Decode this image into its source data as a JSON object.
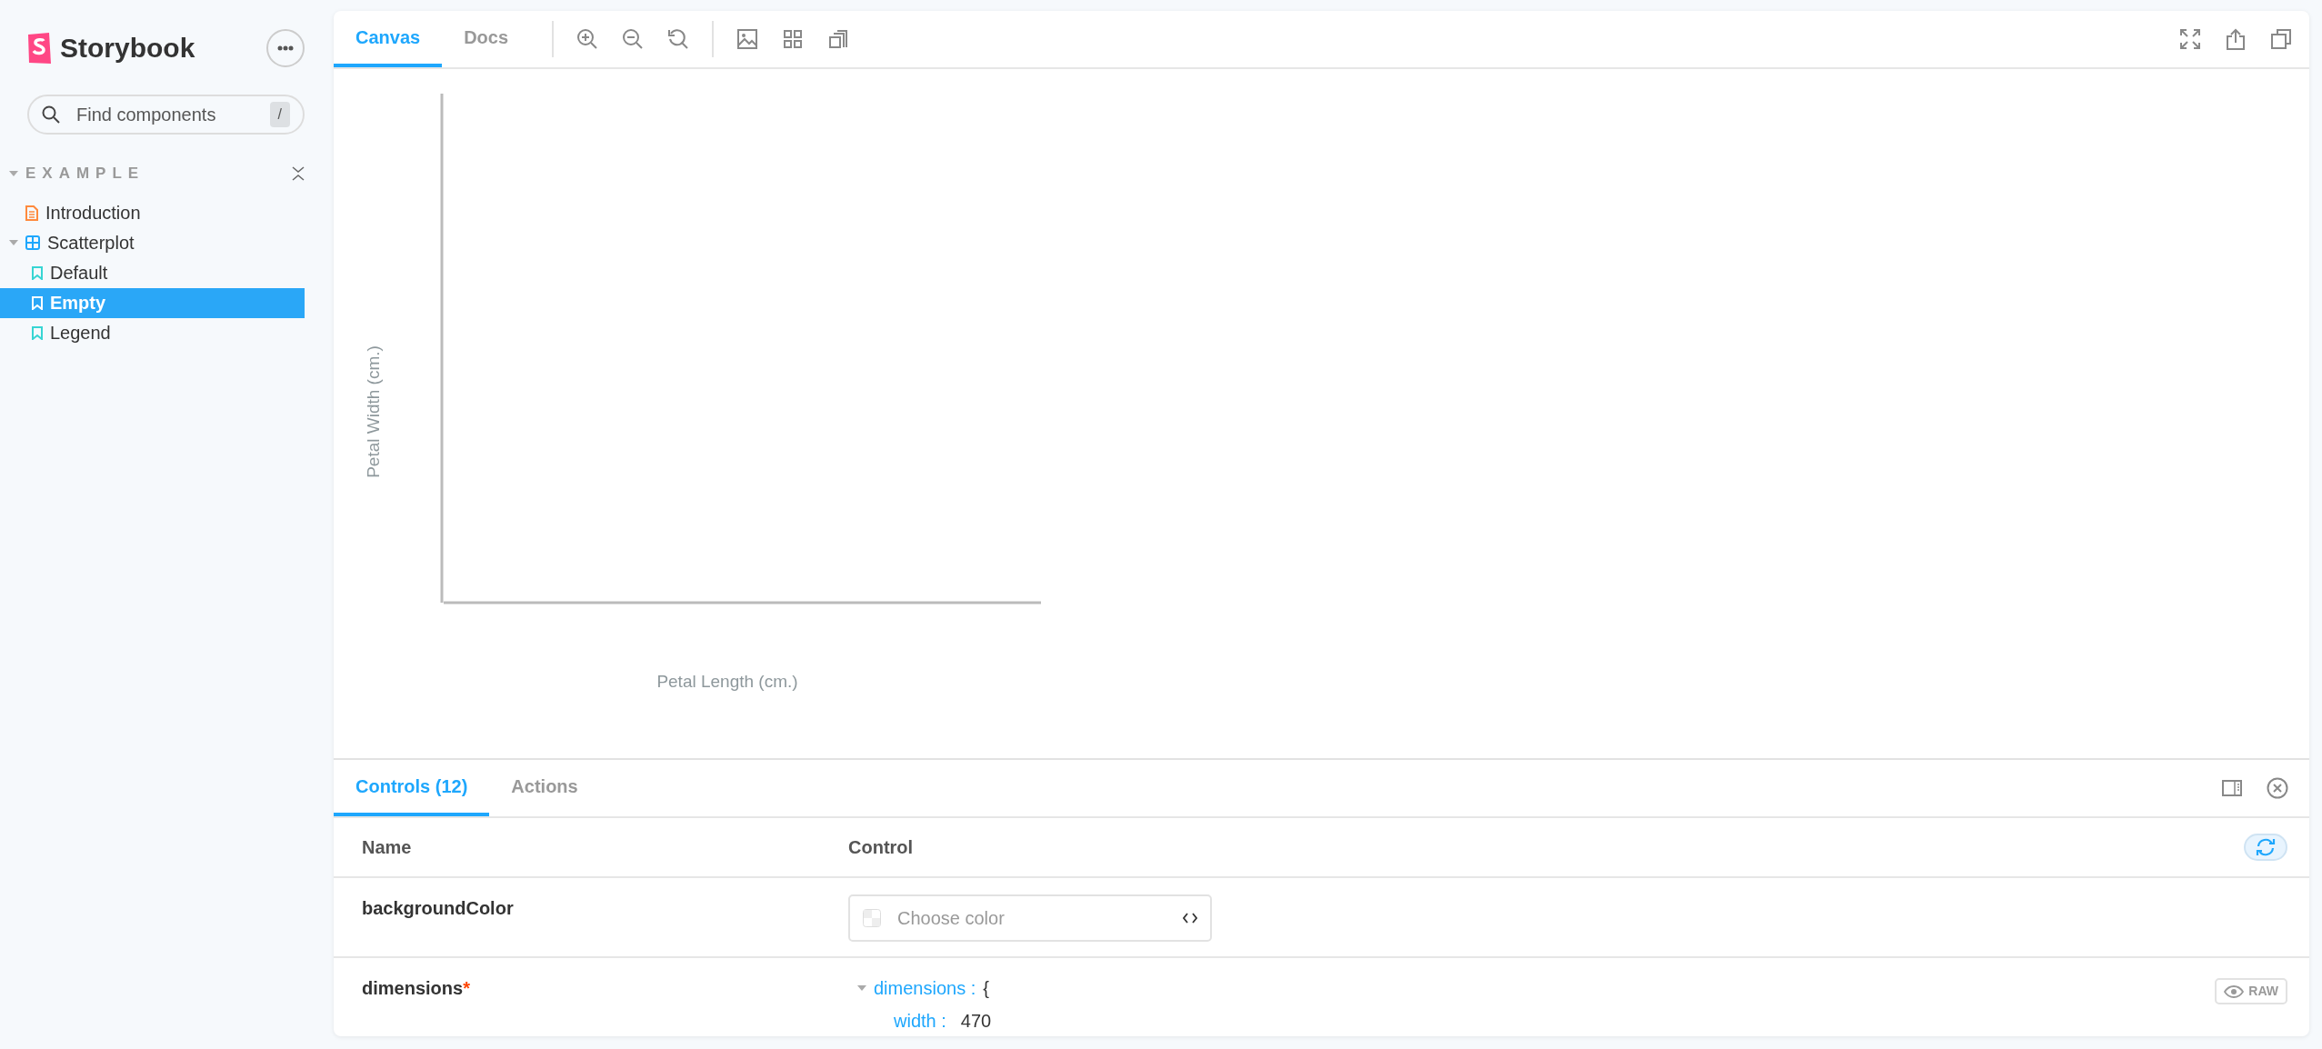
{
  "sidebar": {
    "brand": "Storybook",
    "search": {
      "placeholder": "Find components",
      "shortcut": "/"
    },
    "section": {
      "label": "EXAMPLE",
      "expanded": true
    },
    "tree": [
      {
        "label": "Introduction",
        "kind": "docs",
        "selected": false
      },
      {
        "label": "Scatterplot",
        "kind": "component",
        "selected": false,
        "expanded": true,
        "children": [
          {
            "label": "Default",
            "kind": "story",
            "selected": false
          },
          {
            "label": "Empty",
            "kind": "story",
            "selected": true
          },
          {
            "label": "Legend",
            "kind": "story",
            "selected": false
          }
        ]
      }
    ]
  },
  "toolbar": {
    "tabs": [
      {
        "label": "Canvas",
        "selected": true
      },
      {
        "label": "Docs",
        "selected": false
      }
    ]
  },
  "preview": {
    "ylabel": "Petal Width (cm.)",
    "xlabel": "Petal Length (cm.)"
  },
  "addons": {
    "tabs": [
      {
        "label": "Controls (12)",
        "selected": true
      },
      {
        "label": "Actions",
        "selected": false
      }
    ],
    "columns": [
      "Name",
      "Control"
    ],
    "rows": [
      {
        "name": "backgroundColor",
        "kind": "color",
        "placeholder": "Choose color"
      },
      {
        "name": "dimensions",
        "required_marker": "*",
        "kind": "object",
        "raw_button": "RAW",
        "object": {
          "key": "dimensions :",
          "expanded": true,
          "brace": "{",
          "fields": [
            {
              "key": "width :",
              "value": "470"
            }
          ]
        }
      }
    ]
  }
}
